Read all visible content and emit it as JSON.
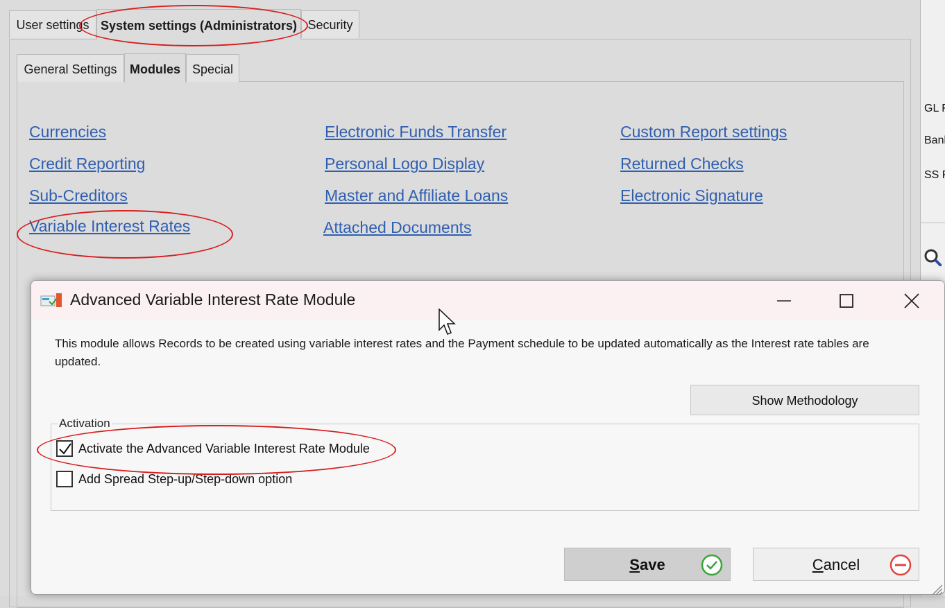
{
  "outer_tabs": [
    {
      "label": "User settings"
    },
    {
      "label": "System settings (Administrators)"
    },
    {
      "label": "Security"
    }
  ],
  "inner_tabs": [
    {
      "label": "General Settings"
    },
    {
      "label": "Modules"
    },
    {
      "label": "Special"
    }
  ],
  "modules": {
    "col1": [
      "Currencies",
      "Credit Reporting",
      "Sub-Creditors",
      "Variable Interest Rates"
    ],
    "col2": [
      "Electronic Funds Transfer",
      "Personal Logo Display",
      "Master and Affiliate Loans",
      "Attached Documents"
    ],
    "col3": [
      "Custom Report settings",
      "Returned Checks",
      "Electronic Signature"
    ]
  },
  "side_panel": {
    "labels": [
      "GL F",
      "Bank",
      "SS F"
    ],
    "icon": "magnifier-icon"
  },
  "dialog": {
    "title": "Advanced Variable Interest Rate Module",
    "icon": "module-icon",
    "description": "This module allows Records to be created using variable interest rates and the Payment schedule to be updated automatically as the Interest rate tables are updated.",
    "methodology_button": "Show Methodology",
    "activation": {
      "legend": "Activation",
      "options": [
        {
          "label": "Activate the Advanced Variable Interest Rate Module",
          "checked": true
        },
        {
          "label": "Add Spread Step-up/Step-down option",
          "checked": false
        }
      ]
    },
    "save_button": {
      "prefix": "",
      "underlined": "S",
      "rest": "ave",
      "icon": "check-circle-icon"
    },
    "cancel_button": {
      "prefix": "",
      "underlined": "C",
      "rest": "ancel",
      "icon": "minus-circle-icon"
    }
  },
  "colors": {
    "link": "#2f5fb0",
    "annotation": "#d81e1e",
    "save_icon": "#3aa53a",
    "cancel_icon": "#e0453c"
  }
}
